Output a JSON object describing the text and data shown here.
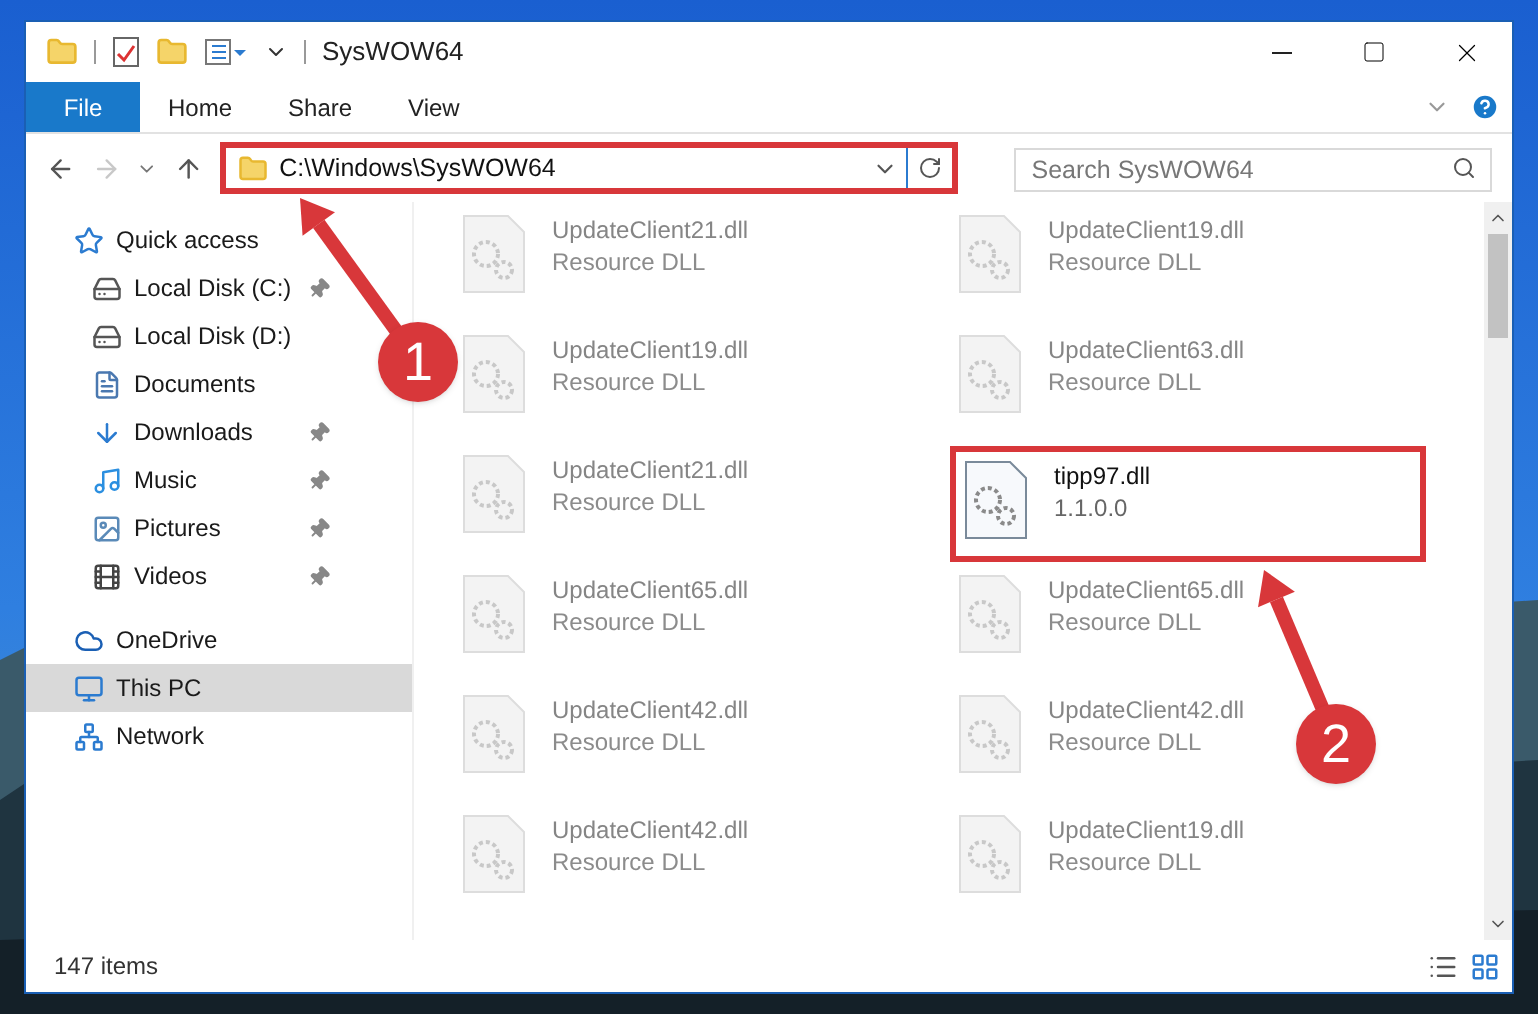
{
  "window": {
    "title": "SysWOW64"
  },
  "ribbon_tabs": [
    {
      "label": "File",
      "kind": "file"
    },
    {
      "label": "Home",
      "kind": "tab"
    },
    {
      "label": "Share",
      "kind": "tab"
    },
    {
      "label": "View",
      "kind": "tab"
    }
  ],
  "navigation": {
    "forward_disabled": true
  },
  "address_bar": {
    "path": "C:\\Windows\\SysWOW64",
    "highlighted": true
  },
  "search": {
    "placeholder": "Search SysWOW64"
  },
  "sidebar": {
    "items": [
      {
        "label": "Quick access",
        "kind": "star",
        "selected": false,
        "pinned": false,
        "children": [
          {
            "label": "Local Disk (C:)",
            "kind": "drive",
            "selected": false,
            "pinned": true
          },
          {
            "label": "Local Disk (D:)",
            "kind": "drive",
            "selected": false,
            "pinned": false
          },
          {
            "label": "Documents",
            "kind": "documents",
            "selected": false,
            "pinned": false
          },
          {
            "label": "Downloads",
            "kind": "downloads",
            "selected": false,
            "pinned": true
          },
          {
            "label": "Music",
            "kind": "music",
            "selected": false,
            "pinned": true
          },
          {
            "label": "Pictures",
            "kind": "pictures",
            "selected": false,
            "pinned": true
          },
          {
            "label": "Videos",
            "kind": "videos",
            "selected": false,
            "pinned": true
          }
        ]
      },
      {
        "label": "OneDrive",
        "kind": "cloud",
        "selected": false,
        "pinned": false
      },
      {
        "label": "This PC",
        "kind": "pc",
        "selected": true,
        "pinned": false
      },
      {
        "label": "Network",
        "kind": "network",
        "selected": false,
        "pinned": false
      }
    ]
  },
  "files": [
    {
      "name": "UpdateClient21.dll",
      "detail": "Resource DLL",
      "dimmed": true,
      "highlighted": false
    },
    {
      "name": "UpdateClient19.dll",
      "detail": "Resource DLL",
      "dimmed": true,
      "highlighted": false
    },
    {
      "name": "UpdateClient19.dll",
      "detail": "Resource DLL",
      "dimmed": true,
      "highlighted": false
    },
    {
      "name": "UpdateClient63.dll",
      "detail": "Resource DLL",
      "dimmed": true,
      "highlighted": false
    },
    {
      "name": "UpdateClient21.dll",
      "detail": "Resource DLL",
      "dimmed": true,
      "highlighted": false
    },
    {
      "name": "tipp97.dll",
      "detail": "1.1.0.0",
      "dimmed": false,
      "highlighted": true
    },
    {
      "name": "UpdateClient65.dll",
      "detail": "Resource DLL",
      "dimmed": true,
      "highlighted": false
    },
    {
      "name": "UpdateClient65.dll",
      "detail": "Resource DLL",
      "dimmed": true,
      "highlighted": false
    },
    {
      "name": "UpdateClient42.dll",
      "detail": "Resource DLL",
      "dimmed": true,
      "highlighted": false
    },
    {
      "name": "UpdateClient42.dll",
      "detail": "Resource DLL",
      "dimmed": true,
      "highlighted": false
    },
    {
      "name": "UpdateClient42.dll",
      "detail": "Resource DLL",
      "dimmed": true,
      "highlighted": false
    },
    {
      "name": "UpdateClient19.dll",
      "detail": "Resource DLL",
      "dimmed": true,
      "highlighted": false
    }
  ],
  "status_bar": {
    "count": "147 items"
  },
  "annotations": [
    {
      "number": "1"
    },
    {
      "number": "2"
    }
  ]
}
